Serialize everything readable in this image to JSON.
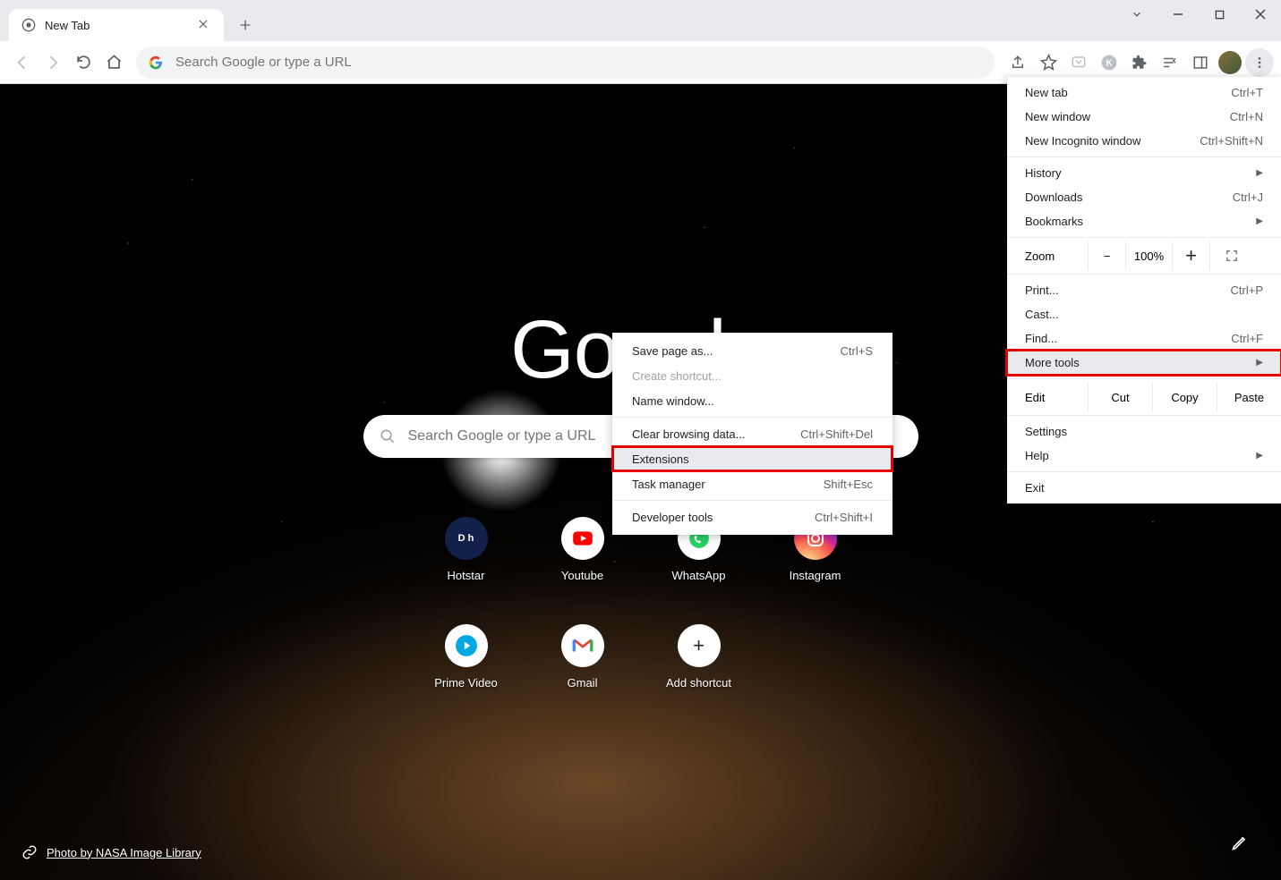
{
  "window": {
    "tab_title": "New Tab",
    "omnibox_placeholder": "Search Google or type a URL"
  },
  "ntp": {
    "logo_text": "Google",
    "search_placeholder": "Search Google or type a URL",
    "shortcuts": [
      {
        "label": "Hotstar"
      },
      {
        "label": "Youtube"
      },
      {
        "label": "WhatsApp"
      },
      {
        "label": "Instagram"
      },
      {
        "label": "Prime Video"
      },
      {
        "label": "Gmail"
      },
      {
        "label": "Add shortcut"
      }
    ],
    "attribution": "Photo by NASA Image Library"
  },
  "menu": {
    "new_tab": {
      "label": "New tab",
      "shortcut": "Ctrl+T"
    },
    "new_window": {
      "label": "New window",
      "shortcut": "Ctrl+N"
    },
    "new_incognito": {
      "label": "New Incognito window",
      "shortcut": "Ctrl+Shift+N"
    },
    "history": {
      "label": "History"
    },
    "downloads": {
      "label": "Downloads",
      "shortcut": "Ctrl+J"
    },
    "bookmarks": {
      "label": "Bookmarks"
    },
    "zoom": {
      "label": "Zoom",
      "value": "100%"
    },
    "print": {
      "label": "Print...",
      "shortcut": "Ctrl+P"
    },
    "cast": {
      "label": "Cast..."
    },
    "find": {
      "label": "Find...",
      "shortcut": "Ctrl+F"
    },
    "more_tools": {
      "label": "More tools"
    },
    "edit": {
      "label": "Edit",
      "cut": "Cut",
      "copy": "Copy",
      "paste": "Paste"
    },
    "settings": {
      "label": "Settings"
    },
    "help": {
      "label": "Help"
    },
    "exit": {
      "label": "Exit"
    }
  },
  "submenu": {
    "save_page": {
      "label": "Save page as...",
      "shortcut": "Ctrl+S"
    },
    "create_shortcut": {
      "label": "Create shortcut..."
    },
    "name_window": {
      "label": "Name window..."
    },
    "clear_data": {
      "label": "Clear browsing data...",
      "shortcut": "Ctrl+Shift+Del"
    },
    "extensions": {
      "label": "Extensions"
    },
    "task_manager": {
      "label": "Task manager",
      "shortcut": "Shift+Esc"
    },
    "dev_tools": {
      "label": "Developer tools",
      "shortcut": "Ctrl+Shift+I"
    }
  }
}
